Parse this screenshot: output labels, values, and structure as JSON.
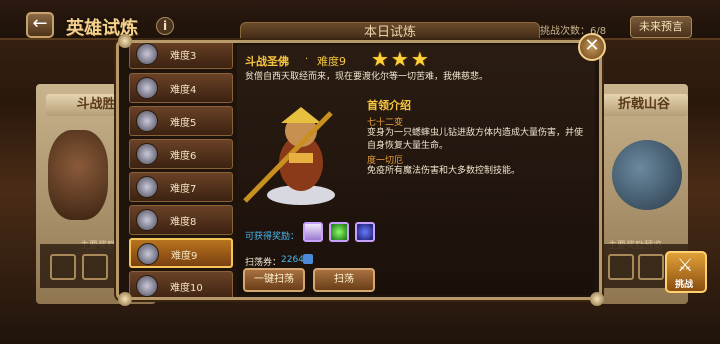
{
  "header": {
    "title": "英雄试炼",
    "today_tab": "本日试炼",
    "remaining": "今日剩余挑战次数：6/8",
    "preview_button": "未来预言"
  },
  "left_side": {
    "label": "斗战胜",
    "rewards_label": "主要奖励"
  },
  "right_side": {
    "label": "折戟山谷",
    "rewards_label": "主要奖励预览"
  },
  "difficulty_list": [
    {
      "label": "难度3"
    },
    {
      "label": "难度4"
    },
    {
      "label": "难度5"
    },
    {
      "label": "难度6"
    },
    {
      "label": "难度7"
    },
    {
      "label": "难度8"
    },
    {
      "label": "难度9",
      "selected": true
    },
    {
      "label": "难度10"
    }
  ],
  "detail": {
    "boss_name": "斗战圣佛",
    "dot": "·",
    "difficulty": "难度9",
    "stars": "★★★",
    "quote": "贫僧自西天取经而来，现在要渡化尔等一切苦难，我佛慈悲。",
    "section_title": "首领介绍",
    "skills": [
      {
        "name": "七十二变",
        "desc": "变身为一只蟋蟀虫儿钻进敌方体内造成大量伤害，并使自身恢复大量生命。"
      },
      {
        "name": "度一切厄",
        "desc": "免疫所有魔法伤害和大多数控制技能。"
      }
    ],
    "reward_label": "可获得奖励：",
    "sweep_label": "扫荡券：",
    "sweep_count": "2264",
    "sweep_all_button": "一键扫荡",
    "sweep_button": "扫荡",
    "fight_button": "挑战"
  },
  "colors": {
    "accent_gold": "#f7c640",
    "info_blue": "#4ab8f0",
    "skill_orange": "#e8a23a"
  }
}
